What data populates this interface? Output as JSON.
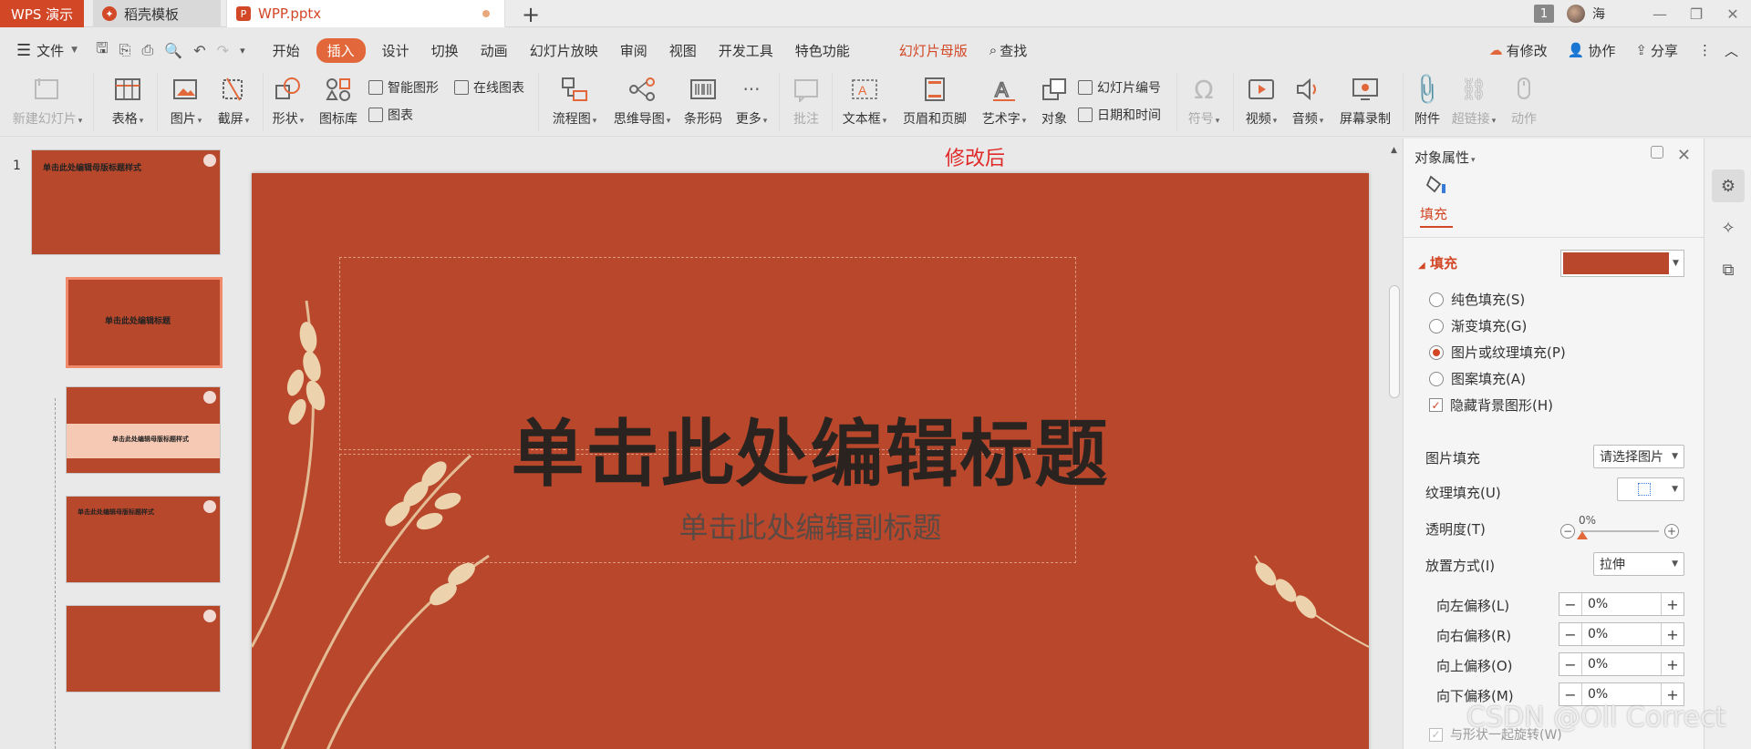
{
  "titlebar": {
    "tabs": [
      {
        "label": "WPS 演示"
      },
      {
        "label": "稻壳模板"
      },
      {
        "label": "WPP.pptx"
      }
    ],
    "window_count": "1",
    "user_name": "海"
  },
  "menubar": {
    "file_label": "文件",
    "tabs": [
      "开始",
      "插入",
      "设计",
      "切换",
      "动画",
      "幻灯片放映",
      "审阅",
      "视图",
      "开发工具",
      "特色功能",
      "幻灯片母版"
    ],
    "active_tab": "插入",
    "search_label": "查找",
    "right": [
      "有修改",
      "协作",
      "分享"
    ]
  },
  "ribbon": {
    "new_slide": "新建幻灯片",
    "table": "表格",
    "picture": "图片",
    "screenshot": "截屏",
    "shape": "形状",
    "icon_lib": "图标库",
    "smart_art": "智能图形",
    "online_chart": "在线图表",
    "chart": "图表",
    "flowchart": "流程图",
    "mindmap": "思维导图",
    "barcode": "条形码",
    "more": "更多",
    "comment": "批注",
    "textbox": "文本框",
    "header_footer": "页眉和页脚",
    "wordart": "艺术字",
    "object": "对象",
    "slide_number": "幻灯片编号",
    "date_time": "日期和时间",
    "symbol": "符号",
    "video": "视频",
    "audio": "音频",
    "screen_record": "屏幕录制",
    "attachment": "附件",
    "hyperlink": "超链接",
    "action": "动作"
  },
  "thumbnails": {
    "slide_number": "1",
    "master_title": "单击此处编辑母版标题样式",
    "layout_title": "单击此处编辑标题",
    "band_title": "单击此处编辑母版标题样式"
  },
  "canvas": {
    "label_after": "修改后",
    "title": "单击此处编辑标题",
    "subtitle": "单击此处编辑副标题"
  },
  "panel": {
    "header": "对象属性",
    "tab_fill": "填充",
    "section_fill": "填充",
    "options": [
      {
        "label": "纯色填充(S)",
        "selected": false
      },
      {
        "label": "渐变填充(G)",
        "selected": false
      },
      {
        "label": "图片或纹理填充(P)",
        "selected": true
      },
      {
        "label": "图案填充(A)",
        "selected": false
      }
    ],
    "hide_bg_label": "隐藏背景图形(H)",
    "hide_bg_checked": true,
    "picture_fill_label": "图片填充",
    "picture_fill_value": "请选择图片",
    "texture_label": "纹理填充(U)",
    "transparency_label": "透明度(T)",
    "transparency_value": "0%",
    "placement_label": "放置方式(I)",
    "placement_value": "拉伸",
    "offsets": [
      {
        "label": "向左偏移(L)",
        "value": "0%"
      },
      {
        "label": "向右偏移(R)",
        "value": "0%"
      },
      {
        "label": "向上偏移(O)",
        "value": "0%"
      },
      {
        "label": "向下偏移(M)",
        "value": "0%"
      }
    ],
    "rotate_label": "与形状一起旋转(W)"
  },
  "watermark": "CSDN @Oll Correct",
  "colors": {
    "accent": "#d24726",
    "slide_bg": "#b8472b",
    "active_tab": "#e2683c"
  }
}
